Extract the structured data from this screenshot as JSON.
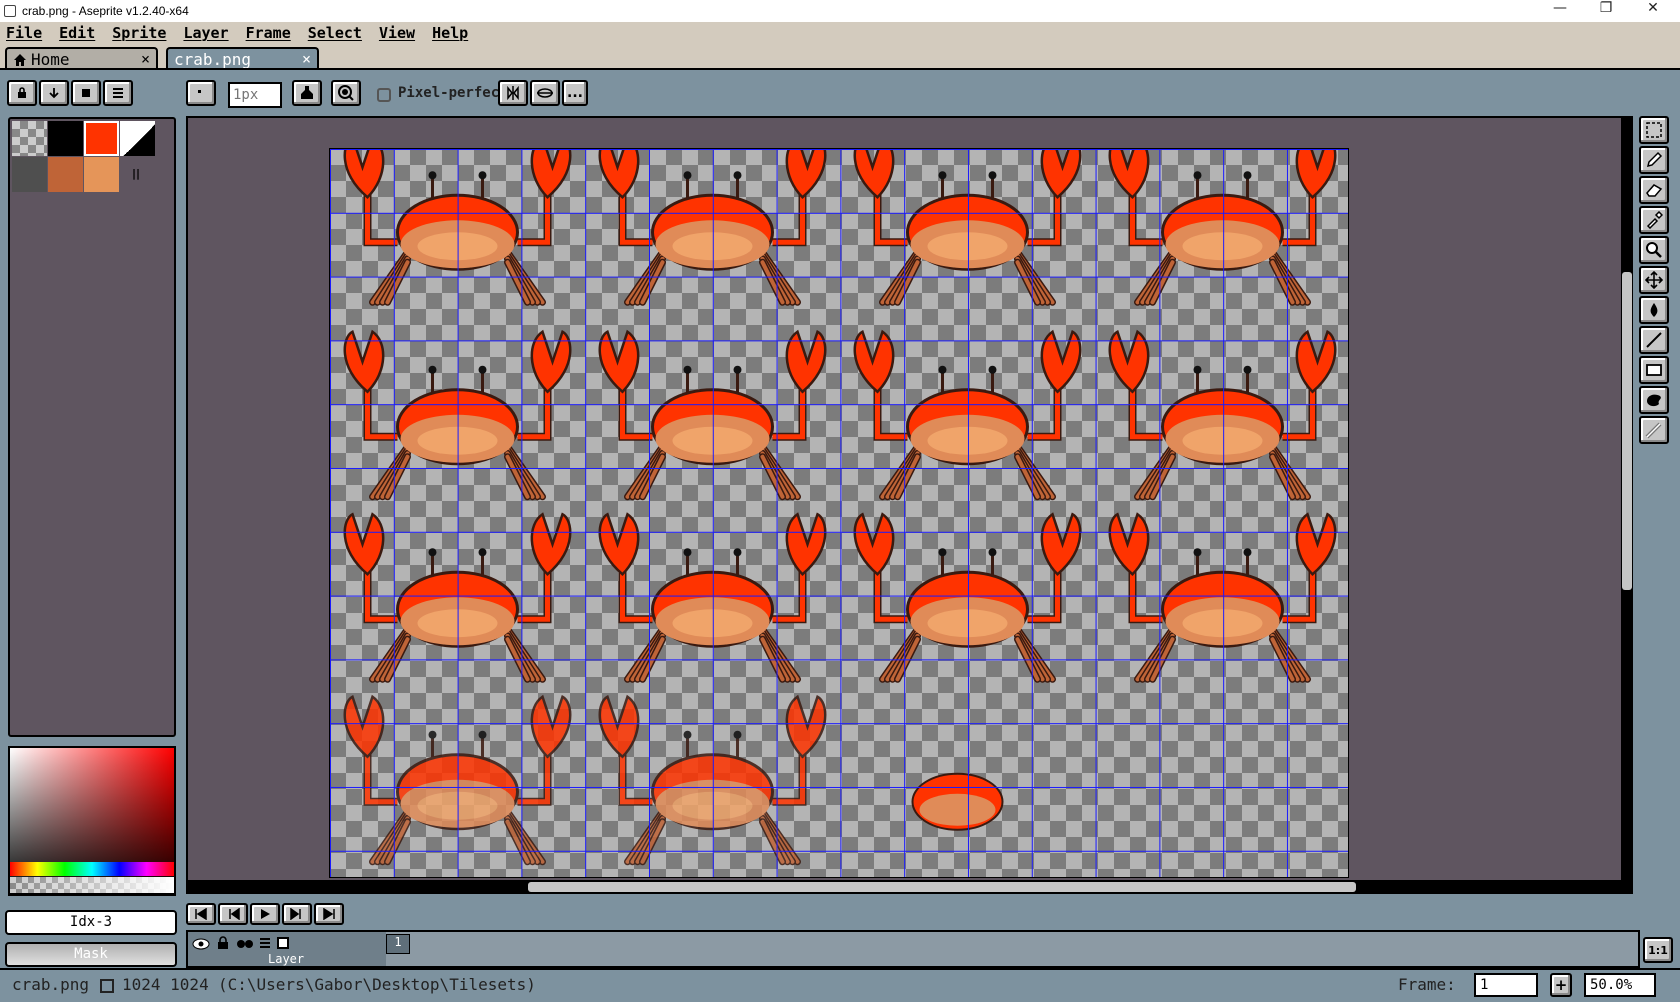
{
  "window": {
    "title": "crab.png - Aseprite v1.2.40-x64",
    "minimize": "—",
    "maximize": "❐",
    "close": "✕"
  },
  "menu": [
    "File",
    "Edit",
    "Sprite",
    "Layer",
    "Frame",
    "Select",
    "View",
    "Help"
  ],
  "tabs": [
    {
      "label": "Home",
      "close": "×",
      "icon": "home-icon"
    },
    {
      "label": "crab.png",
      "close": "×"
    }
  ],
  "context_bar": {
    "brush_size_placeholder": "1px",
    "pixel_perfect_label": "Pixel-perfect",
    "more": "..."
  },
  "palette": {
    "swatches": [
      "#000000",
      "#ff3300",
      "#ffffff",
      "#4f4f4f",
      "#bf6437",
      "#e59559"
    ],
    "index_label": "Idx-3",
    "mask_label": "Mask",
    "pause_glyph": "||"
  },
  "canvas": {
    "sprite_columns": 4,
    "sprite_rows": 4,
    "colors": {
      "shell": "#ff3300",
      "belly": "#e08b58",
      "belly_light": "#f0a46a",
      "legs": "#bf6437",
      "outline": "#3a1a10"
    }
  },
  "timeline": {
    "frame_number": "1",
    "layer_name": "Layer"
  },
  "status": {
    "filename": "crab.png",
    "size": "1024  1024",
    "path": "(C:\\Users\\Gabor\\Desktop\\Tilesets)",
    "frame_label": "Frame:",
    "frame_value": "1",
    "add_frame": "+",
    "zoom": "50.0%",
    "ratio_button": "1:1"
  }
}
